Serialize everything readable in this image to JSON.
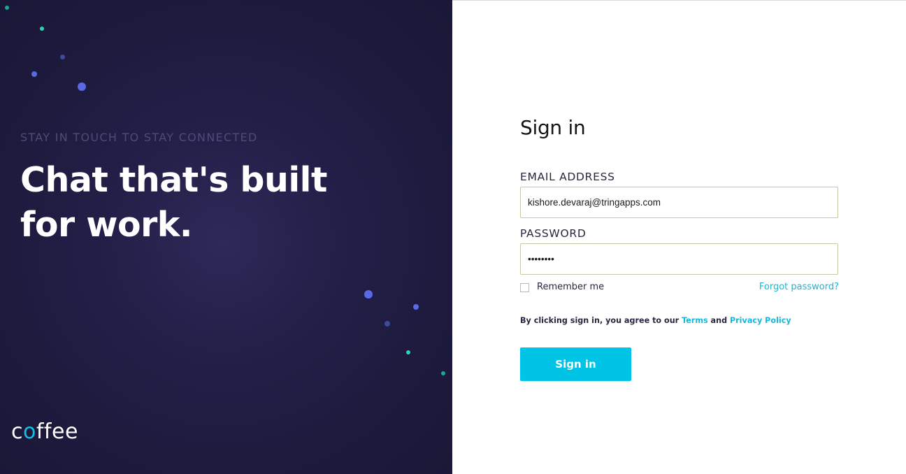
{
  "hero": {
    "tagline": "STAY IN TOUCH TO STAY CONNECTED",
    "headline_line1": "Chat that's built",
    "headline_line2": "for work.",
    "logo_prefix": "c",
    "logo_accent": "o",
    "logo_suffix": "ffee",
    "background_color": "#1f1b42",
    "dot_colors": [
      "#2fd3b0",
      "#5a6ae6",
      "#3e4a9a",
      "#1aa88e"
    ]
  },
  "form": {
    "title": "Sign in",
    "email_label": "EMAIL ADDRESS",
    "email_value": "kishore.devaraj@tringapps.com",
    "password_label": "PASSWORD",
    "password_value": "••••••••",
    "remember_label": "Remember me",
    "forgot_label": "Forgot password?",
    "agree_prefix": "By clicking sign in, you agree to our ",
    "terms_label": "Terms",
    "agree_and": " and ",
    "privacy_label": "Privacy Policy",
    "submit_label": "Sign in",
    "accent_color": "#00c4e5"
  }
}
